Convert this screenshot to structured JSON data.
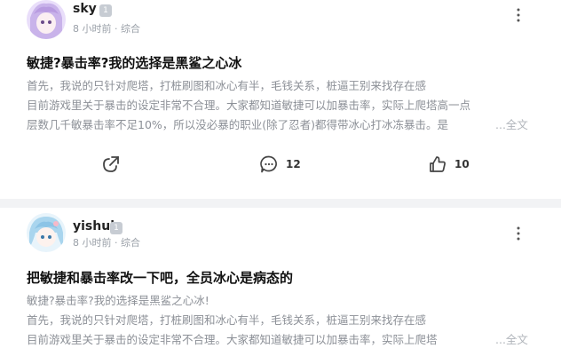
{
  "posts": [
    {
      "author": "sky",
      "level": "1",
      "time": "8 小时前",
      "section": "· 综合",
      "title": "敏捷?暴击率?我的选择是黑鲨之心冰",
      "lines": [
        "首先，我说的只针对爬塔，打桩刷图和冰心有半，毛钱关系，桩逼王别来找存在感",
        "目前游戏里关于暴击的设定非常不合理。大家都知道敏捷可以加暴击率，实际上爬塔高一点",
        "层数几千敏暴击率不足10%，所以没必暴的职业(除了忍者)都得带冰心打冰冻暴击。是"
      ],
      "more": "...全文",
      "comments": "12",
      "likes": "10"
    },
    {
      "author": "yishul",
      "level": "1",
      "time": "8 小时前",
      "section": "· 综合",
      "title": "把敏捷和暴击率改一下吧，全员冰心是病态的",
      "lines": [
        "敏捷?暴击率?我的选择是黑鲨之心冰!",
        "首先，我说的只针对爬塔，打桩刷图和冰心有半，毛钱关系，桩逼王别来找存在感",
        "目前游戏里关于暴击的设定非常不合理。大家都知道敏捷可以加暴击率，实际上爬塔"
      ],
      "more": "...全文"
    }
  ],
  "colors": {
    "divider": "#f2f3f5",
    "meta": "#9aa0a8",
    "body_text": "#8c9097"
  },
  "icons": {
    "share": "share-icon",
    "comment": "comment-icon",
    "like": "thumbs-up-icon",
    "more": "more-vertical-icon"
  }
}
